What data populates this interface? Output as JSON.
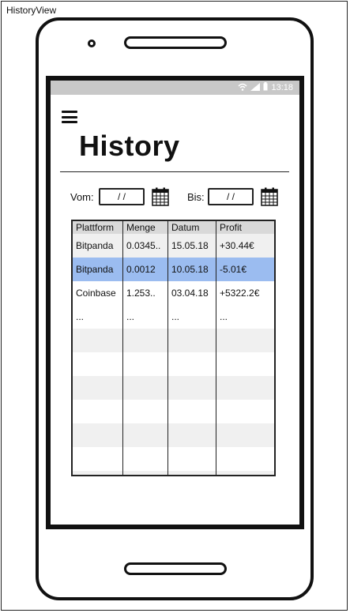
{
  "window": {
    "title": "HistoryView"
  },
  "statusbar": {
    "time": "13:18"
  },
  "page": {
    "title": "History"
  },
  "filter": {
    "from_label": "Vom:",
    "from_value": "/ /",
    "to_label": "Bis:",
    "to_value": "/ /"
  },
  "table": {
    "headers": [
      "Plattform",
      "Menge",
      "Datum",
      "Profit"
    ],
    "rows": [
      [
        "Bitpanda",
        "0.0345..",
        "15.05.18",
        "+30.44€"
      ],
      [
        "Bitpanda",
        "0.0012",
        "10.05.18",
        "-5.01€"
      ],
      [
        "Coinbase",
        "1.253..",
        "03.04.18",
        "+5322.2€"
      ],
      [
        "...",
        "...",
        "...",
        "..."
      ]
    ],
    "selected_row_index": 1
  },
  "icons": {
    "menu": "hamburger-icon",
    "calendar": "calendar-icon",
    "wifi": "wifi-icon",
    "signal": "signal-icon",
    "battery": "battery-icon"
  },
  "colors": {
    "selected_row": "#9bbcf0",
    "header_bg": "#d9d9d9",
    "statusbar_bg": "#c8c8c8"
  }
}
